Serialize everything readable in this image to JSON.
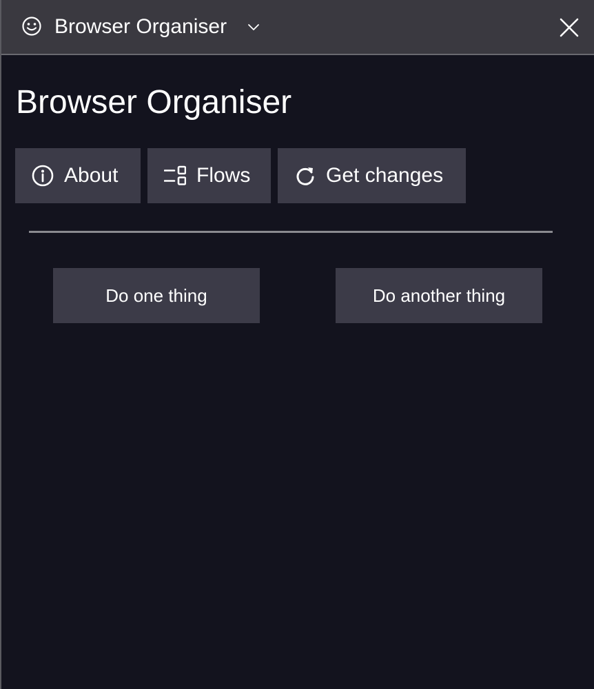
{
  "window": {
    "title": "Browser Organiser",
    "icons": {
      "app": "smiley-icon",
      "menu": "chevron-down-icon",
      "close": "close-icon"
    }
  },
  "page": {
    "title": "Browser Organiser"
  },
  "toolbar": {
    "about_label": "About",
    "flows_label": "Flows",
    "get_changes_label": "Get changes",
    "icons": {
      "about": "info-icon",
      "flows": "flows-icon",
      "get_changes": "refresh-icon"
    }
  },
  "actions": {
    "do_one_thing_label": "Do one thing",
    "do_another_thing_label": "Do another thing"
  },
  "colors": {
    "background": "#13131e",
    "titlebar": "#3a3940",
    "button": "#3c3b48",
    "divider": "#8a8a90",
    "text": "#ffffff"
  }
}
